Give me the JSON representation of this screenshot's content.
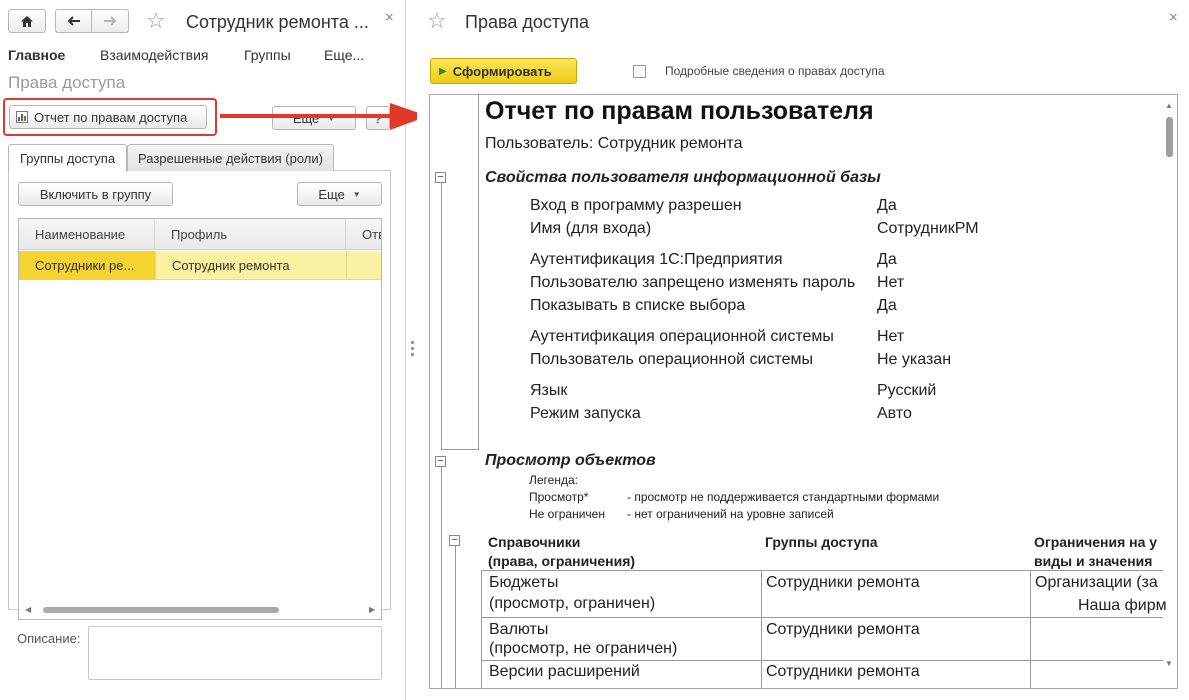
{
  "left": {
    "title": "Сотрудник ремонта ...",
    "nav": {
      "main": "Главное",
      "interaction": "Взаимодействия",
      "groups": "Группы",
      "more": "Еще..."
    },
    "section_title": "Права доступа",
    "toolbar": {
      "report_button": "Отчет по правам доступа",
      "more_button": "Еще",
      "help_button": "?"
    },
    "tabs": [
      "Группы доступа",
      "Разрешенные действия (роли)"
    ],
    "group_toolbar": {
      "include_button": "Включить в группу",
      "more_button": "Еще"
    },
    "table": {
      "columns": [
        "Наименование",
        "Профиль",
        "Отв"
      ],
      "rows": [
        [
          "Сотрудники ре...",
          "Сотрудник ремонта",
          ""
        ]
      ]
    },
    "description_label": "Описание:"
  },
  "right": {
    "title": "Права доступа",
    "generate_button": "Сформировать",
    "detail_checkbox_label": "Подробные сведения о правах доступа",
    "report": {
      "title": "Отчет по правам пользователя",
      "user_line": "Пользователь: Сотрудник ремонта",
      "props_section": "Свойства пользователя информационной базы",
      "props": [
        {
          "k": "Вход в программу разрешен",
          "v": "Да"
        },
        {
          "k": "Имя (для входа)",
          "v": "СотрудникРМ"
        },
        {
          "k": "Аутентификация 1С:Предприятия",
          "v": "Да"
        },
        {
          "k": "Пользователю запрещено изменять пароль",
          "v": "Нет"
        },
        {
          "k": "Показывать в списке выбора",
          "v": "Да"
        },
        {
          "k": "Аутентификация операционной системы",
          "v": "Нет"
        },
        {
          "k": "Пользователь операционной системы",
          "v": "Не указан"
        },
        {
          "k": "Язык",
          "v": "Русский"
        },
        {
          "k": "Режим запуска",
          "v": "Авто"
        }
      ],
      "view_section": "Просмотр объектов",
      "legend_title": "Легенда:",
      "legend": [
        {
          "k": "Просмотр*",
          "v": "- просмотр не поддерживается стандартными формами"
        },
        {
          "k": "Не ограничен",
          "v": "- нет ограничений на уровне записей"
        }
      ],
      "table_headers": {
        "col1_line1": "Справочники",
        "col1_line2": "(права, ограничения)",
        "col2": "Группы доступа",
        "col3_line1": "Ограничения на у",
        "col3_line2": "виды и значения"
      },
      "rows": [
        {
          "name": "Бюджеты",
          "rights": "(просмотр, ограничен)",
          "group": "Сотрудники ремонта",
          "restr1": "Организации (за",
          "restr2": "Наша фирм"
        },
        {
          "name": "Валюты",
          "rights": "(просмотр, не ограничен)",
          "group": "Сотрудники ремонта",
          "restr1": "",
          "restr2": ""
        },
        {
          "name": "Версии расширений",
          "rights": "",
          "group": "Сотрудники ремонта",
          "restr1": "",
          "restr2": ""
        }
      ]
    }
  },
  "colors": {
    "accent_yellow": "#f5d431",
    "selected_row": "#fbf1a3",
    "highlight_red": "#e2382a",
    "generate_button": "#efcd14"
  }
}
